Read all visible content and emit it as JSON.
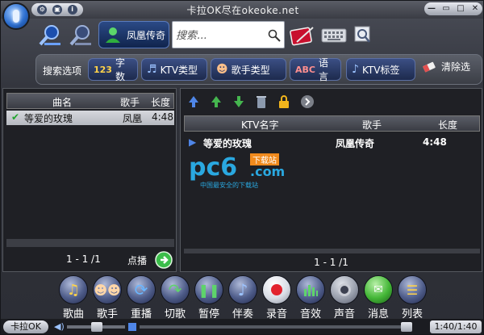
{
  "window": {
    "title": "卡拉OK尽在okeoke.net"
  },
  "toolbar": {
    "user_label": "凤凰传奇",
    "search_placeholder": "搜索..."
  },
  "filters": {
    "label": "搜索选项",
    "chips": [
      {
        "label": "字数",
        "icon": "digits-icon"
      },
      {
        "label": "KTV类型",
        "icon": "music-type-icon"
      },
      {
        "label": "歌手类型",
        "icon": "singers-icon"
      },
      {
        "label": "语言",
        "icon": "language-icon"
      },
      {
        "label": "KTV标签",
        "icon": "tag-icon"
      }
    ],
    "clear_label": "清除选"
  },
  "playlist": {
    "columns": [
      "曲名",
      "歌手",
      "长度"
    ],
    "rows": [
      {
        "title": "等爱的玫瑰",
        "artist": "凤凰",
        "length": "4:48"
      }
    ],
    "page": "1 - 1 /1",
    "play_label": "点播"
  },
  "results": {
    "columns": [
      "KTV名字",
      "歌手",
      "长度"
    ],
    "rows": [
      {
        "title": "等爱的玫瑰",
        "artist": "凤凰传奇",
        "length": "4:48"
      }
    ],
    "page": "1 - 1 /1"
  },
  "watermark": {
    "brand": "pc6",
    "badge": "下载站",
    "domain": ".com",
    "slogan": "中国最安全的下载站"
  },
  "actions": [
    {
      "label": "歌曲",
      "icon": "song-icon"
    },
    {
      "label": "歌手",
      "icon": "singer-icon"
    },
    {
      "label": "重播",
      "icon": "replay-icon"
    },
    {
      "label": "切歌",
      "icon": "next-song-icon"
    },
    {
      "label": "暂停",
      "icon": "pause-icon"
    },
    {
      "label": "伴奏",
      "icon": "accompaniment-icon"
    },
    {
      "label": "录音",
      "icon": "record-icon"
    },
    {
      "label": "音效",
      "icon": "equalizer-icon"
    },
    {
      "label": "声音",
      "icon": "speaker-icon"
    },
    {
      "label": "消息",
      "icon": "message-icon"
    },
    {
      "label": "列表",
      "icon": "list-icon"
    }
  ],
  "status": {
    "mode_label": "卡拉OK",
    "time": "1:40/1:40",
    "progress": 1.0
  },
  "colors": {
    "accent": "#2d6fd0",
    "background": "#2c2e35",
    "check": "#21a52d"
  }
}
